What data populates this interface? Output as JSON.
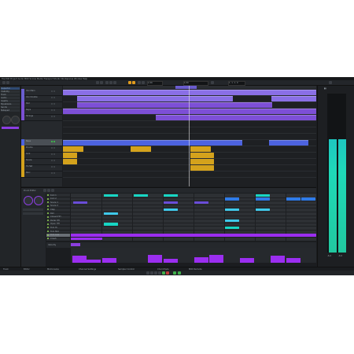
{
  "app": {
    "menu": "File  Edit  Project  Audio  MIDI  Scores  Media  Transport  Studio  Workspaces  Window  Help"
  },
  "toolbar": {
    "position_display": "1. 1. 1. 0",
    "grid_label": "1/16",
    "quantize_label": "1/16"
  },
  "inspector": {
    "rows": [
      "Inspector",
      "Visibility",
      "Track",
      "Audio",
      "Inserts",
      "Equalizers",
      "Sends",
      "Notepad"
    ]
  },
  "tracks": [
    {
      "name": "Vox Main",
      "color": "#6a5fd0"
    },
    {
      "name": "Vox Double",
      "color": "#6a5fd0"
    },
    {
      "name": "Pad",
      "color": "#7b50d4"
    },
    {
      "name": "Keys",
      "color": "#7b50d4"
    },
    {
      "name": "Strings",
      "color": "#7b50d4"
    },
    {
      "name": "Bass",
      "color": "#4d63e0"
    },
    {
      "name": "Drums",
      "color": "#d4a21c"
    },
    {
      "name": "Kick",
      "color": "#d4a21c"
    },
    {
      "name": "Snare",
      "color": "#d4a21c"
    },
    {
      "name": "Hi-Hat",
      "color": "#d4a21c"
    },
    {
      "name": "Perc",
      "color": "#d4a21c"
    }
  ],
  "drum_map": [
    "Kick 1",
    "Kick 2",
    "Snare 1",
    "Snare 2",
    "Clap",
    "Rim",
    "Closed HH",
    "Pedal HH",
    "Open HH",
    "Tom Hi",
    "Tom Mid",
    "Tom Low",
    "Crash"
  ],
  "editor": {
    "title": "Drum Editor",
    "velocity_label": "Velocity"
  },
  "meter": {
    "left_level": 0.72,
    "right_level": 0.72,
    "label_left": "-6.2",
    "label_right": "-6.0"
  },
  "status": {
    "items": [
      "Track",
      "Editor",
      "MixConsole",
      "Channel Settings",
      "Sampler Control",
      "Chord Pads",
      "MIDI Remote"
    ]
  },
  "colors": {
    "accent": "#e09b1d",
    "purple_clip": "#8a6fe6",
    "blue_clip": "#4d63e0",
    "yellow_clip": "#d4a21c",
    "note_teal": "#17d6c4",
    "note_purple": "#9b2ef0",
    "meter": "#1fd9b8"
  }
}
